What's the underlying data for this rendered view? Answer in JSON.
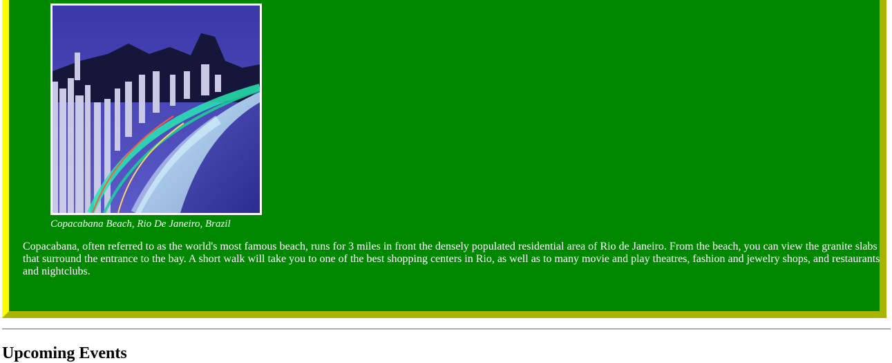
{
  "featured_destination": {
    "image": {
      "icon": "beach-photo",
      "colors": {
        "sky": "#2b2a8e",
        "mountain": "#141430",
        "sea": "#3a3fa8",
        "sand": "#9fb7d8",
        "lights": "#28e6b4"
      }
    },
    "caption": "Copacabana Beach, Rio De Janeiro, Brazil",
    "description": "Copacabana, often referred to as the world's most famous beach, runs for 3 miles in front the densely populated residential area of Rio de Janeiro. From the beach, you can view the granite slabs that surround the entrance to the bay. A short walk will take you to one of the best shopping centers in Rio, as well as to many movie and play theatres, fashion and jewelry shops, and restaurants and nightclubs."
  },
  "events": {
    "heading": "Upcoming Events"
  },
  "theme": {
    "panel_background": "#008800",
    "panel_border_light": "#ffff00",
    "panel_border_dark": "#a8b400",
    "text_on_panel": "#ffffff"
  }
}
